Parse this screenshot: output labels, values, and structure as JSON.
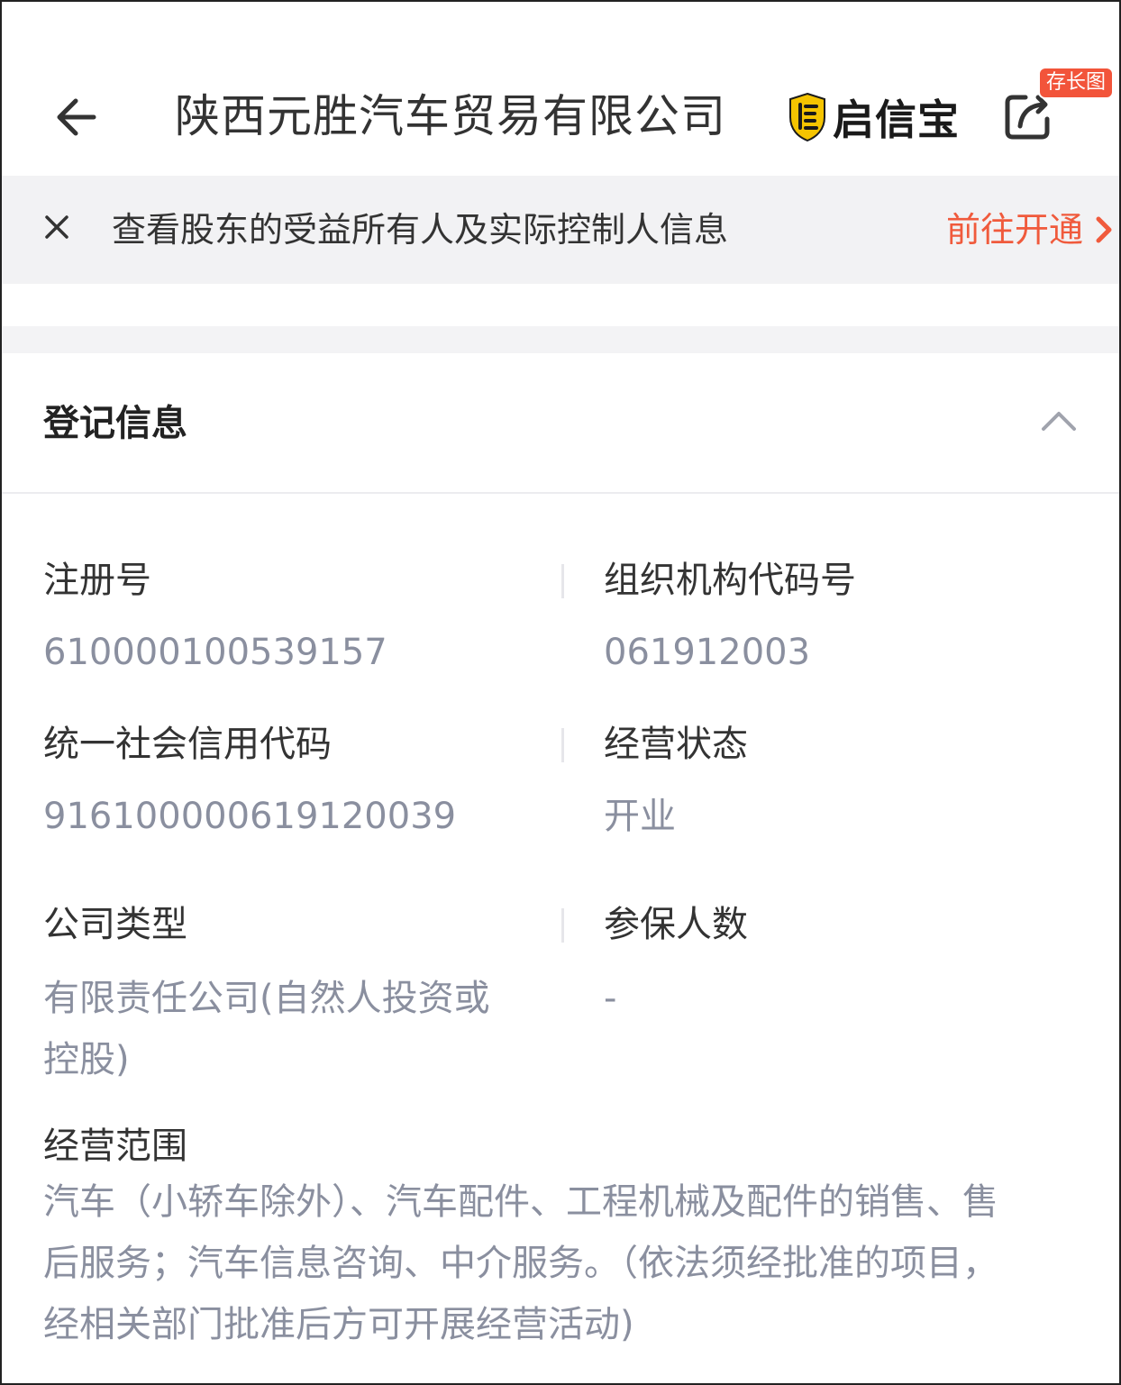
{
  "header": {
    "title": "陕西元胜汽车贸易有限公司",
    "brand_name": "启信宝",
    "badge": "存长图"
  },
  "banner": {
    "text": "查看股东的受益所有人及实际控制人信息",
    "link_label": "前往开通"
  },
  "section": {
    "title": "登记信息"
  },
  "fields": {
    "reg_no": {
      "label": "注册号",
      "value": "610000100539157"
    },
    "org_code": {
      "label": "组织机构代码号",
      "value": "061912003"
    },
    "credit_code": {
      "label": "统一社会信用代码",
      "value": "91610000061912003​9"
    },
    "status": {
      "label": "经营状态",
      "value": "开业"
    },
    "company_type": {
      "label": "公司类型",
      "line1": "有限责任公司(自然人投资或",
      "line2": "控股)"
    },
    "insured": {
      "label": "参保人数",
      "value": "-"
    },
    "scope": {
      "label": "经营范围",
      "line1": "汽车（小轿车除外）、汽车配件、工程机械及配件的销售、售",
      "line2": "后服务；汽车信息咨询、中介服务。（依法须经批准的项目，",
      "line3": "经相关部门批准后方可开展经营活动)"
    }
  },
  "colors": {
    "accent": "#f05a3c",
    "badge": "#f2543a",
    "brand_gold": "#f5c400",
    "value_text": "#8a8f9f",
    "banner_bg": "#f2f2f4"
  },
  "icons": [
    "back-arrow-icon",
    "shield-logo-icon",
    "share-icon",
    "close-icon",
    "chevron-right-icon",
    "chevron-up-icon"
  ]
}
